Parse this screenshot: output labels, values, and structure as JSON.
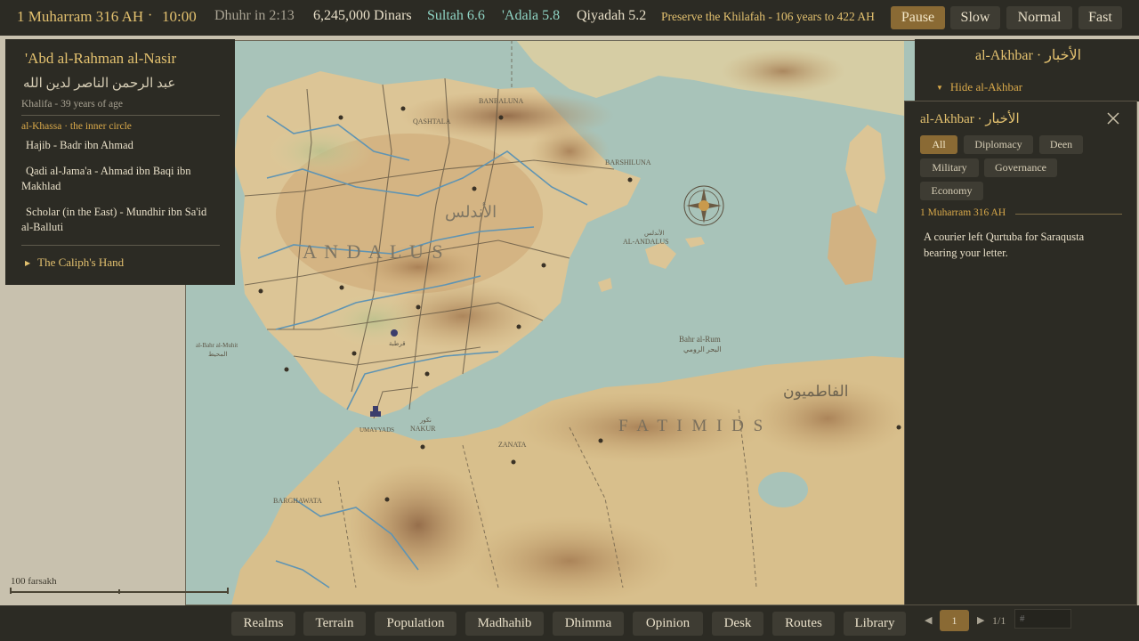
{
  "topbar": {
    "date": "1 Muharram 316 AH",
    "sep": "·",
    "time": "10:00",
    "prayer": "Dhuhr in 2:13",
    "treasury": "6,245,000 Dinars",
    "sultah": "Sultah 6.6",
    "adala": "'Adala 5.8",
    "qiyadah": "Qiyadah 5.2",
    "objective": "Preserve the Khilafah - 106 years to 422 AH",
    "speeds": [
      "Pause",
      "Slow",
      "Normal",
      "Fast"
    ],
    "active_speed": "Pause"
  },
  "character": {
    "name": "'Abd al-Rahman al-Nasir",
    "name_arabic": "عبد الرحمن الناصر لدين الله",
    "subtitle": "Khalifa - 39 years of age",
    "circle_title": "al-Khassa · the inner circle",
    "members": [
      "Hajib - Badr ibn Ahmad",
      "Qadi al-Jama'a - Ahmad ibn Baqi ibn Makhlad",
      "Scholar (in the East) - Mundhir ibn Sa'id al-Balluti"
    ],
    "caliph_hand": "The Caliph's Hand"
  },
  "akhbar_header": {
    "title": "al-Akhbar · الأخبار",
    "hide_label": "Hide al-Akhbar"
  },
  "news": {
    "title": "al-Akhbar · الأخبار",
    "filters": [
      "All",
      "Diplomacy",
      "Deen",
      "Military",
      "Governance",
      "Economy"
    ],
    "active_filter": "All",
    "date": "1 Muharram 316 AH",
    "message": "A courier left Qurtuba for Saraqusta bearing your letter.",
    "page": "1",
    "page_count": "1/1",
    "page_input_placeholder": "#"
  },
  "tabs": [
    "Realms",
    "Terrain",
    "Population",
    "Madhahib",
    "Dhimma",
    "Opinion",
    "Desk",
    "Routes",
    "Library"
  ],
  "map_labels": {
    "andalus_big": "A N D A L U S",
    "andalus_arabic": "الأندلس",
    "fatimids_big": "F A T I M I D S",
    "fatimids_arabic": "الفاطميون",
    "bahr_rum": "Bahr al-Rum",
    "bahr_rum_ar": "البحر الرومي",
    "bahr_muhit": "al-Bahr al-Muhit",
    "bahr_muhit_ar": "المحيط",
    "al_andalus_small": "AL-ANDALUS",
    "al_andalus_small_ar": "الأندلس",
    "barshiluna": "BARSHILUNA",
    "qashtala": "QASHTALA",
    "banbaluna": "BANBALUNA",
    "nakur": "NAKUR",
    "nakur_ar": "نكور",
    "zanata": "ZANATA",
    "barghawata": "BARGHAWATA",
    "umayyads": "UMAYYADS",
    "qurtuba_ar": "قرطبة"
  },
  "scale": "100 farsakh",
  "colors": {
    "panel_bg": "#2c2b24",
    "accent_gold": "#e3c16f",
    "active_button": "#8a6a34",
    "sea": "#a8c3b9"
  }
}
